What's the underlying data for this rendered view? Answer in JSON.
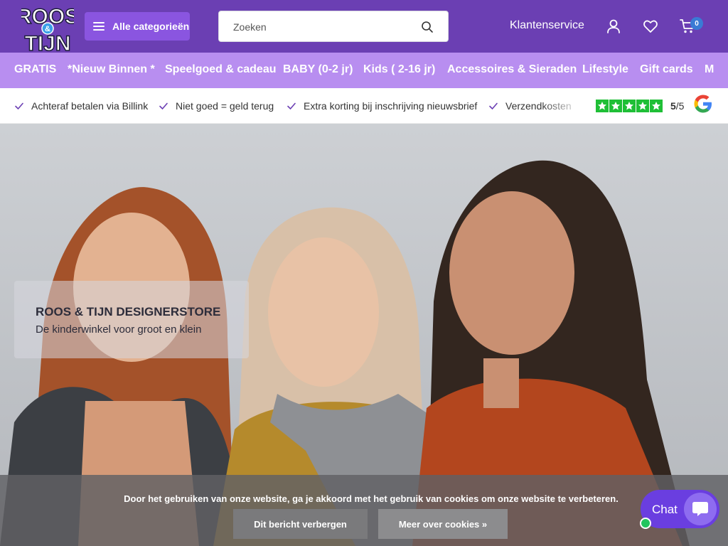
{
  "header": {
    "logo_line1": "ROOS",
    "logo_amp": "&",
    "logo_line2": "TIJN",
    "categories_label": "Alle categorieën",
    "search_placeholder": "Zoeken",
    "customer_service": "Klantenservice",
    "cart_count": "0",
    "icons": [
      "menu-icon",
      "search-icon",
      "user-icon",
      "heart-icon",
      "cart-icon"
    ]
  },
  "nav": {
    "items": [
      {
        "label": "GRATIS"
      },
      {
        "label": "*Nieuw Binnen *"
      },
      {
        "label": "Speelgoed & cadeau"
      },
      {
        "label": "BABY (0-2 jr)"
      },
      {
        "label": "Kids ( 2-16 jr)"
      },
      {
        "label": "Accessoires & Sieraden"
      },
      {
        "label": "Lifestyle"
      },
      {
        "label": "Gift cards"
      },
      {
        "label": "M"
      }
    ]
  },
  "usp": {
    "items": [
      {
        "label": "Achteraf betalen via Billink"
      },
      {
        "label": "Niet goed = geld terug"
      },
      {
        "label": "Extra korting bij inschrijving nieuwsbrief"
      },
      {
        "label": "Verzendkosten"
      }
    ],
    "rating_score": "5",
    "rating_max": "/5",
    "star_count": 5
  },
  "hero": {
    "title": "ROOS & TIJN DESIGNERSTORE",
    "subtitle": "De kinderwinkel voor groot en klein"
  },
  "cookie": {
    "text": "Door het gebruiken van onze website, ga je akkoord met het gebruik van cookies om onze website te verbeteren.",
    "hide_label": "Dit bericht verbergen",
    "more_label": "Meer over cookies »"
  },
  "chat": {
    "label": "Chat"
  },
  "colors": {
    "header_bg": "#6b3fb3",
    "nav_bg": "#b88ef0",
    "category_button": "#8a55e0",
    "star_green": "#1fbf36",
    "chat_bg": "#6a3ee0",
    "online_dot": "#22c55e"
  }
}
